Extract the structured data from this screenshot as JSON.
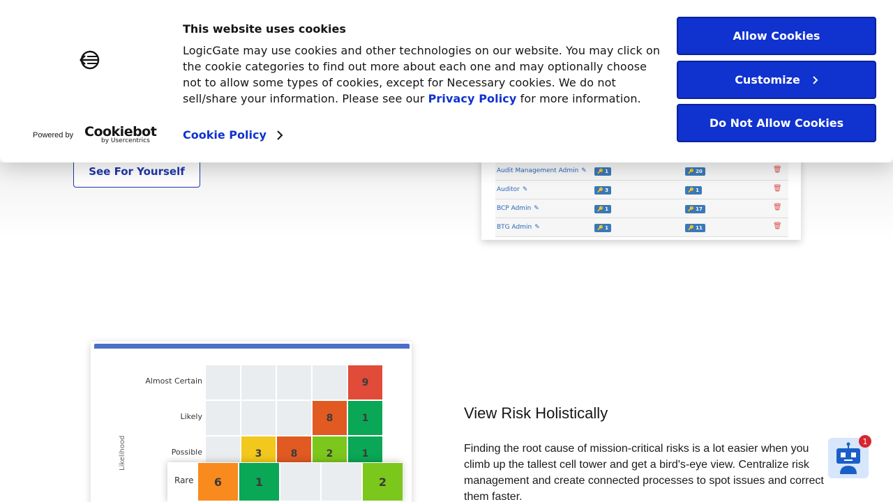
{
  "cookie_banner": {
    "title": "This website uses cookies",
    "body_before_link": "LogicGate may use cookies and other technologies on our website. You may click on the cookie categories to find out more about each one and may optionally choose not to allow some types of cookies, except for Necessary cookies.  We do not sell/share your information. Please see our ",
    "privacy_link": "Privacy Policy",
    "body_after_link": " for more information.",
    "cookie_policy_link": "Cookie Policy",
    "powered_by": "Powered by",
    "cookiebot_logo_text": "Cookiebot",
    "cookiebot_sub": "by Usercentrics",
    "buttons": {
      "allow": "Allow Cookies",
      "customize": "Customize",
      "deny": "Do Not Allow Cookies"
    },
    "colors": {
      "primary": "#1032cf"
    }
  },
  "hero": {
    "cta_label": "See For Yourself"
  },
  "roles_table": {
    "rows": [
      {
        "name": "Audit Management Admin",
        "count_a": "1",
        "count_b": "20"
      },
      {
        "name": "Auditor",
        "count_a": "3",
        "count_b": "1"
      },
      {
        "name": "BCP Admin",
        "count_a": "1",
        "count_b": "17"
      },
      {
        "name": "BTG Admin",
        "count_a": "1",
        "count_b": "11"
      }
    ]
  },
  "heatmap": {
    "axis_label": "Likelihood",
    "rows": [
      {
        "label": "Almost Certain",
        "cells": [
          "",
          "",
          "",
          "",
          "9"
        ]
      },
      {
        "label": "Likely",
        "cells": [
          "",
          "",
          "",
          "8",
          "1"
        ]
      },
      {
        "label": "Possible",
        "cells": [
          "",
          "3",
          "8",
          "2",
          "1"
        ]
      }
    ],
    "rare_row": {
      "label": "Rare",
      "cells": [
        "6",
        "1",
        "",
        "",
        "2"
      ]
    },
    "colors": {
      "red": "#e04b3a",
      "orange": "#e05a22",
      "yellow": "#f2c81c",
      "green": "#0aa756",
      "lime": "#7cc71c",
      "light_orange": "#f98a1e",
      "empty": "#eaedf0"
    }
  },
  "section": {
    "title": "View Risk Holistically",
    "body": "Finding the root cause of mission-critical risks is a lot easier when you climb up the tallest cell tower and get a bird's-eye view. Centralize risk management and create connected processes to spot issues and correct them faster."
  },
  "chatbot": {
    "badge": "1",
    "icon": "robot-icon"
  }
}
